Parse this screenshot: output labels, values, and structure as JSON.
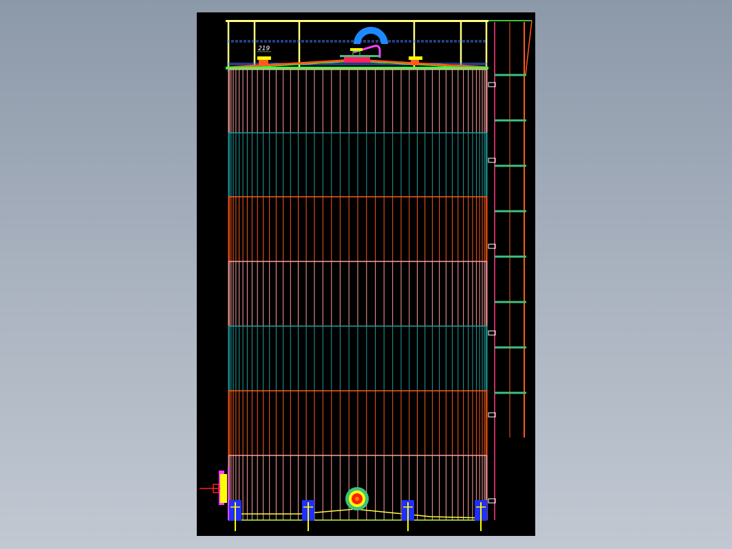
{
  "drawing": {
    "background": "#000000",
    "label_219": "219",
    "colors": {
      "roof_frame": "#ffff80",
      "roof_green": "#40ff40",
      "roof_blue": "#4060ff",
      "pink_band": "#ff9f9f",
      "teal_band": "#20a0a0",
      "orange_band": "#ff5a1a",
      "ladder": "#ff5a1a",
      "ladder_green": "#40c080",
      "magenta": "#ff40ff",
      "pump_blue": "#2030ff",
      "yellow": "#ffff00"
    },
    "shell_courses": [
      {
        "name": "course-1",
        "color": "pink"
      },
      {
        "name": "course-2",
        "color": "teal"
      },
      {
        "name": "course-3",
        "color": "orange"
      },
      {
        "name": "course-4",
        "color": "pink"
      },
      {
        "name": "course-5",
        "color": "teal"
      },
      {
        "name": "course-6",
        "color": "orange"
      },
      {
        "name": "course-7",
        "color": "pink"
      }
    ]
  }
}
